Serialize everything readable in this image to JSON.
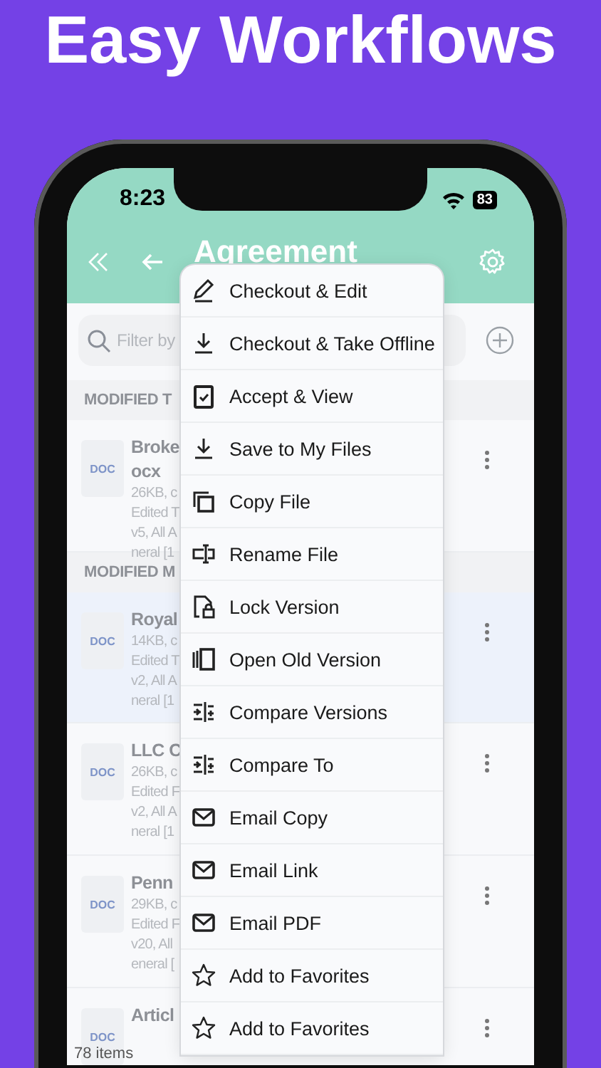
{
  "headline": "Easy Workflows",
  "status_bar": {
    "time": "8:23",
    "battery": "83"
  },
  "header": {
    "title": "Agreement"
  },
  "search": {
    "placeholder": "Filter by"
  },
  "sections": [
    {
      "title": "MODIFIED T",
      "rows": [
        {
          "type_label": "DOC",
          "name_lines": [
            "Broke",
            "ocx"
          ],
          "details": [
            "26KB, c",
            "Edited T",
            "v5, All A",
            "neral [1"
          ],
          "selected": false
        }
      ]
    },
    {
      "title": "MODIFIED M",
      "rows": [
        {
          "type_label": "DOC",
          "name_lines": [
            "Royal"
          ],
          "details": [
            "14KB, c",
            "Edited T",
            "v2, All A",
            "neral [1"
          ],
          "selected": true
        },
        {
          "type_label": "DOC",
          "name_lines": [
            "LLC C"
          ],
          "details": [
            "26KB, c",
            "Edited F",
            "v2, All A",
            "neral [1"
          ],
          "selected": false
        },
        {
          "type_label": "DOC",
          "name_lines": [
            "Penn"
          ],
          "details": [
            "29KB, c",
            "Edited F",
            "v20, All",
            "eneral ["
          ],
          "selected": false
        },
        {
          "type_label": "DOC",
          "name_lines": [
            "Articl"
          ],
          "details": [],
          "selected": false
        }
      ]
    }
  ],
  "footer": "78 items",
  "menu": [
    {
      "label": "Checkout & Edit",
      "kind": "pencil"
    },
    {
      "label": "Checkout & Take Offline",
      "kind": "download"
    },
    {
      "label": "Accept & View",
      "kind": "clipboard"
    },
    {
      "label": "Save to My Files",
      "kind": "download"
    },
    {
      "label": "Copy File",
      "kind": "copy"
    },
    {
      "label": "Rename File",
      "kind": "rename"
    },
    {
      "label": "Lock Version",
      "kind": "lock"
    },
    {
      "label": "Open Old Version",
      "kind": "panels"
    },
    {
      "label": "Compare Versions",
      "kind": "compare"
    },
    {
      "label": "Compare To",
      "kind": "compare"
    },
    {
      "label": "Email Copy",
      "kind": "mail"
    },
    {
      "label": "Email Link",
      "kind": "mail"
    },
    {
      "label": "Email PDF",
      "kind": "mail"
    },
    {
      "label": "Add to Favorites",
      "kind": "star"
    },
    {
      "label": "Add to Favorites",
      "kind": "star"
    }
  ]
}
